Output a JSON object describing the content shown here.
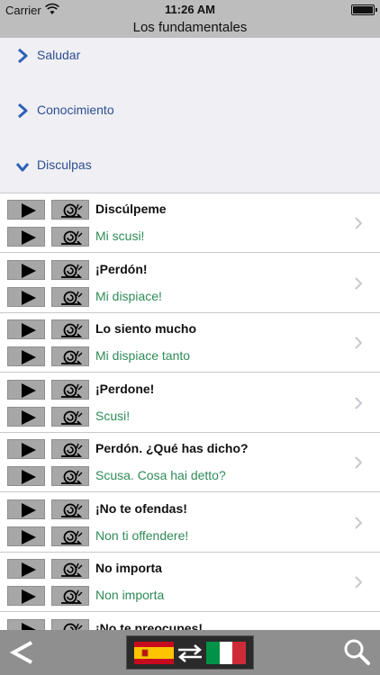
{
  "status_bar": {
    "carrier": "Carrier",
    "time": "11:26 AM"
  },
  "header": {
    "title": "Los fundamentales"
  },
  "categories": [
    {
      "label": "Saludar",
      "expanded": false
    },
    {
      "label": "Conocimiento",
      "expanded": false
    },
    {
      "label": "Disculpas",
      "expanded": true
    }
  ],
  "phrases": [
    {
      "source": "Discúlpeme",
      "translation": "Mi scusi!"
    },
    {
      "source": "¡Perdón!",
      "translation": "Mi dispiace!"
    },
    {
      "source": "Lo siento mucho",
      "translation": "Mi dispiace tanto"
    },
    {
      "source": "¡Perdone!",
      "translation": "Scusi!"
    },
    {
      "source": "Perdón. ¿Qué has dicho?",
      "translation": "Scusa. Cosa hai detto?"
    },
    {
      "source": "¡No te ofendas!",
      "translation": "Non ti offendere!"
    },
    {
      "source": "No importa",
      "translation": "Non importa"
    },
    {
      "source": "¡No te preocupes!",
      "translation": ""
    }
  ],
  "toolbar": {
    "back_icon": "back-chevron-icon",
    "source_language_flag": "spain-flag",
    "target_language_flag": "italy-flag",
    "search_icon": "magnifier-icon"
  },
  "colors": {
    "title_bar": "#bdbdbd",
    "category_bg": "#efeff4",
    "category_text": "#2e4f92",
    "translation_text": "#2e8b57",
    "toolbar": "#8f8f8f"
  }
}
